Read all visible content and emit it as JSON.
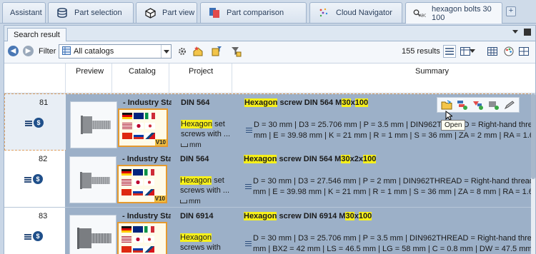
{
  "tabs": [
    {
      "label": "Assistant",
      "icon": "none"
    },
    {
      "label": "Part selection",
      "icon": "database-icon"
    },
    {
      "label": "Part view",
      "icon": "cube-icon"
    },
    {
      "label": "Part comparison",
      "icon": "compare-icon"
    },
    {
      "label": "Cloud Navigator",
      "icon": "cloud-dots-icon"
    },
    {
      "label": "hexagon bolts 30 100",
      "icon": "search-abc-icon",
      "active": true
    }
  ],
  "panel": {
    "tab_label": "Search result"
  },
  "toolbar": {
    "filter_label": "Filter",
    "filter_value": "All catalogs",
    "results": "155 results"
  },
  "table": {
    "headers": {
      "preview": "Preview",
      "catalog": "Catalog",
      "project": "Project",
      "summary": "Summary"
    },
    "rows": [
      {
        "num": "81",
        "catalog_name": "- Industry Star",
        "version": "V10",
        "project_title": "DIN 564",
        "desc_hl": "Hexagon",
        "desc_rest": " set screws with ...",
        "desc_mm": "mm",
        "sum_hl1": "Hexagon",
        "sum_mid": " screw DIN 564 M",
        "sum_hl2": "30",
        "sum_x": "x",
        "sum_hl3": "100",
        "line1": "D = 30 mm | D3 = 25.706 mm | P = 3.5 mm | DIN962THREAD = Right-hand thread | L = 10",
        "line2": "mm | E = 39.98 mm | K = 21 mm | R = 1 mm | S = 36 mm | ZA = 2 mm | RA = 1.6 mm | Z = 1"
      },
      {
        "num": "82",
        "catalog_name": "- Industry Star",
        "version": "V10",
        "project_title": "DIN 564",
        "desc_hl": "Hexagon",
        "desc_rest": " set screws with ...",
        "desc_mm": "mm",
        "sum_hl1": "Hexagon",
        "sum_mid": " screw DIN 564 M",
        "sum_hl2": "30",
        "sum_x": "x2x",
        "sum_hl3": "100",
        "line1": "D = 30 mm | D3 = 27.546 mm | P = 2 mm | DIN962THREAD = Right-hand thread | L = 100",
        "line2": "mm | E = 39.98 mm | K = 21 mm | R = 1 mm | S = 36 mm | ZA = 8 mm | RA = 1.6 mm | Z = 1"
      },
      {
        "num": "83",
        "catalog_name": "- Industry Star",
        "version": "",
        "project_title": "DIN 6914",
        "desc_hl": "Hexagon",
        "desc_rest": " screws with large w...",
        "desc_mm": "",
        "sum_hl1": "Hexagon",
        "sum_mid": " screw DIN 6914 M",
        "sum_hl2": "30",
        "sum_x": "x",
        "sum_hl3": "100",
        "line1": "D = 30 mm | D3 = 25.706 mm | P = 3.5 mm | DIN962THREAD = Right-hand thread | L = 100",
        "line2": "mm | BX2 = 42 mm | LS = 46.5 mm | LG = 58 mm | C = 0.8 mm | DW = 47.5 mm | E = 55.37"
      }
    ]
  },
  "tooltip": "Open",
  "colors": {
    "accent": "#9cb0c8",
    "highlight": "#f7f01a",
    "link": "#1a3ca8",
    "selection_border": "#e59a2f"
  }
}
